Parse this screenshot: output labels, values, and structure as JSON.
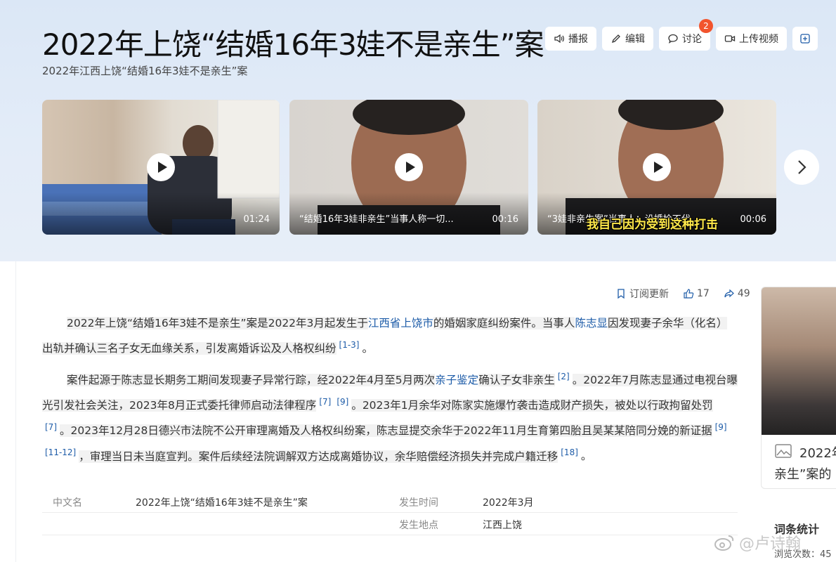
{
  "header": {
    "title": "2022年上饶“结婚16年3娃不是亲生”案",
    "subtitle": "2022年江西上饶“结婚16年3娃不是亲生”案"
  },
  "toolbar": {
    "broadcast": "播报",
    "edit": "编辑",
    "discuss": "讨论",
    "discuss_badge": "2",
    "upload_video": "上传视频"
  },
  "videos": [
    {
      "caption": "",
      "duration": "01:24",
      "subtitle": ""
    },
    {
      "caption": "“结婚16年3娃非亲生”当事人称一切...",
      "duration": "00:16",
      "subtitle": ""
    },
    {
      "caption": "“3娃非亲生案”当事人：设婚检不代...",
      "duration": "00:06",
      "subtitle": "我自己因为受到这种打击"
    }
  ],
  "actions": {
    "subscribe": "订阅更新",
    "likes": "17",
    "shares": "49"
  },
  "paragraph1": {
    "t1": "2022年上饶“结婚16年3娃不是亲生”案是2022年3月起发生于",
    "link1": "江西省上饶市",
    "t2": "的婚姻家庭纠纷案件。当事人",
    "link2": "陈志显",
    "t3": "因发现妻子余华（化名）出轨并确认三名子女无血缘关系，引发离婚诉讼及人格权纠纷",
    "ref1": "[1-3]",
    "t4": "。"
  },
  "paragraph2": {
    "t1": "案件起源于陈志显长期务工期间发现妻子异常行踪，经2022年4月至5月两次",
    "link1": "亲子鉴定",
    "t2": "确认子女非亲生",
    "ref1": "[2]",
    "t3": "。2022年7月陈志显通过电视台曝光引发社会关注，2023年8月正式委托律师启动法律程序",
    "ref2": "[7]",
    "ref3": "[9]",
    "t4": "。2023年1月余华对陈家实施爆竹袭击造成财产损失，被处以行政拘留处罚",
    "ref4": "[7]",
    "t5": "。2023年12月28日德兴市法院不公开审理离婚及人格权纠纷案，陈志显提交余华于2022年11月生育第四胎且吴某某陪同分娩的新证据",
    "ref5": "[9]",
    "ref6": "[11-12]",
    "t6": "，审理当日未当庭宣判。案件后续经法院调解双方达成离婚协议，余华赔偿经济损失并完成户籍迁移",
    "ref7": "[18]",
    "t7": "。"
  },
  "infobox": {
    "row1": {
      "label1": "中文名",
      "value1": "2022年上饶“结婚16年3娃不是亲生”案",
      "label2": "发生时间",
      "value2": "2022年3月"
    },
    "row2": {
      "label2": "发生地点",
      "value2": "江西上饶"
    }
  },
  "sidecard": {
    "line1": "2022年",
    "line2": "亲生”案的"
  },
  "stats": {
    "title": "词条统计",
    "views": "浏览次数：45"
  },
  "watermark": "@卢诗翰",
  "colors": {
    "accent_link": "#1e5ca8",
    "badge": "#f2542d",
    "header_bg": "#dbe7f6"
  }
}
